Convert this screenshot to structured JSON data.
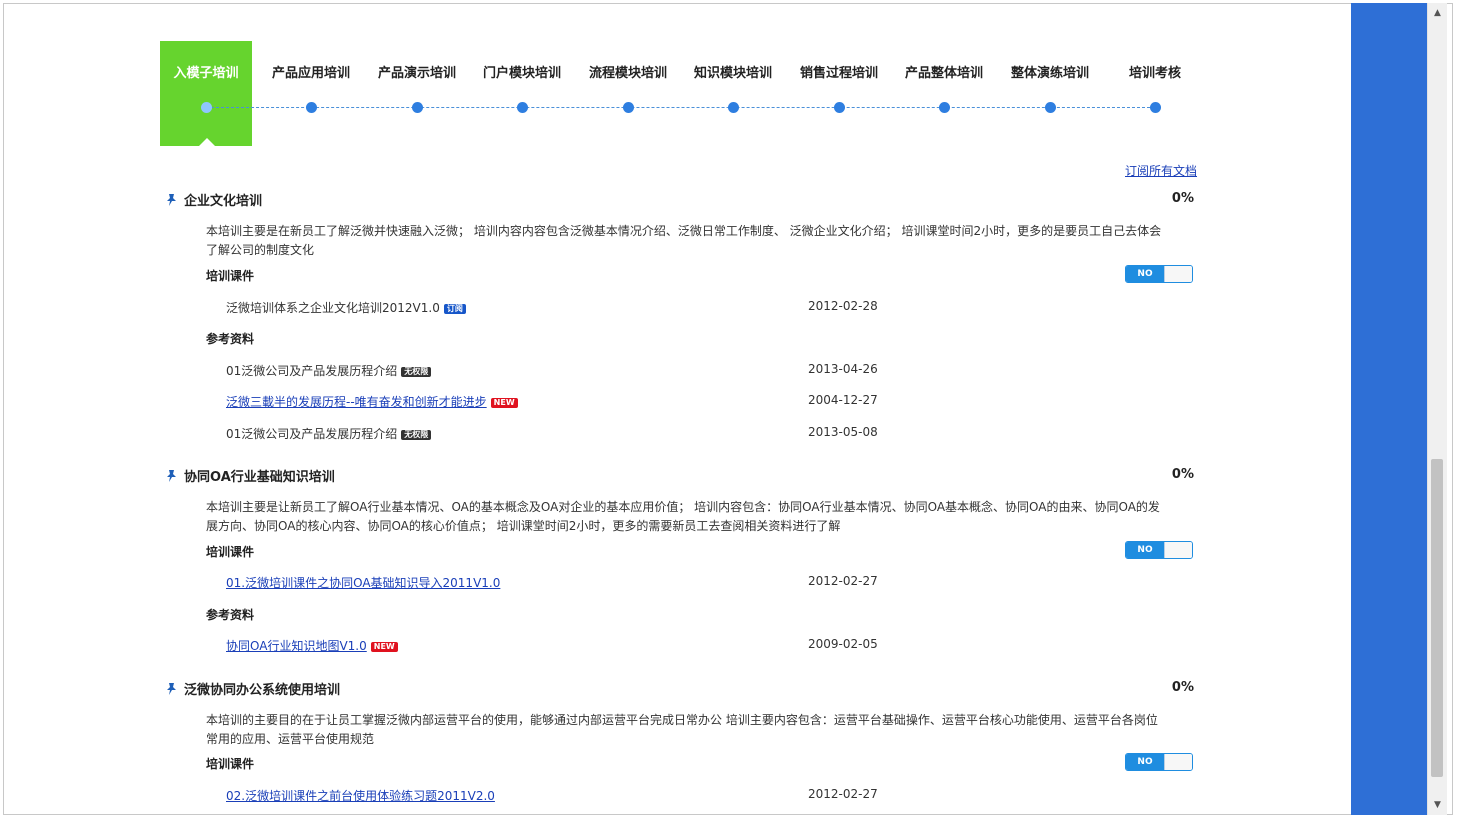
{
  "tabs": [
    {
      "label": "入模子培训",
      "active": true
    },
    {
      "label": "产品应用培训"
    },
    {
      "label": "产品演示培训"
    },
    {
      "label": "门户模块培训"
    },
    {
      "label": "流程模块培训"
    },
    {
      "label": "知识模块培训"
    },
    {
      "label": "销售过程培训"
    },
    {
      "label": "产品整体培训"
    },
    {
      "label": "整体演练培训"
    },
    {
      "label": "培训考核"
    }
  ],
  "subscribe_all": "订阅所有文档",
  "sections": [
    {
      "title": "企业文化培训",
      "percent": "0%",
      "description": "本培训主要是在新员工了解泛微并快速融入泛微； 培训内容内容包含泛微基本情况介绍、泛微日常工作制度、 泛微企业文化介绍； 培训课堂时间2小时，更多的是要员工自己去体会了解公司的制度文化",
      "courseware_label": "培训课件",
      "toggle_label": "NO",
      "courseware": [
        {
          "name": "泛微培训体系之企业文化培训2012V1.0",
          "badge": "订阅",
          "date": "2012-02-28"
        }
      ],
      "reference_label": "参考资料",
      "references": [
        {
          "name": "01泛微公司及产品发展历程介绍",
          "badge": "无权限",
          "date": "2013-04-26"
        },
        {
          "name": "泛微三載半的发展历程--唯有奋发和创新才能进步",
          "badge": "NEW",
          "date": "2004-12-27"
        },
        {
          "name": "01泛微公司及产品发展历程介绍",
          "badge": "无权限",
          "date": "2013-05-08"
        }
      ]
    },
    {
      "title": "协同OA行业基础知识培训",
      "percent": "0%",
      "description": "本培训主要是让新员工了解OA行业基本情况、OA的基本概念及OA对企业的基本应用价值； 培训内容包含：协同OA行业基本情况、协同OA基本概念、协同OA的由来、协同OA的发展方向、协同OA的核心内容、协同OA的核心价值点； 培训课堂时间2小时，更多的需要新员工去查阅相关资料进行了解",
      "courseware_label": "培训课件",
      "toggle_label": "NO",
      "courseware": [
        {
          "name": "01.泛微培训课件之协同OA基础知识导入2011V1.0",
          "date": "2012-02-27"
        }
      ],
      "reference_label": "参考资料",
      "references": [
        {
          "name": "协同OA行业知识地图V1.0",
          "badge": "NEW",
          "date": "2009-02-05"
        }
      ]
    },
    {
      "title": "泛微协同办公系统使用培训",
      "percent": "0%",
      "description": "本培训的主要目的在于让员工掌握泛微内部运营平台的使用，能够通过内部运营平台完成日常办公 培训主要内容包含：运营平台基础操作、运营平台核心功能使用、运营平台各岗位常用的应用、运营平台使用规范",
      "courseware_label": "培训课件",
      "toggle_label": "NO",
      "courseware": [
        {
          "name": "02.泛微培训课件之前台使用体验练习题2011V2.0",
          "date": "2012-02-27"
        }
      ]
    }
  ],
  "colors": {
    "active_tab": "#66d42e",
    "timeline": "#2e7ee0",
    "link": "#1a3fb8",
    "side_panel": "#2e6fd6",
    "toggle": "#1f8de0"
  }
}
